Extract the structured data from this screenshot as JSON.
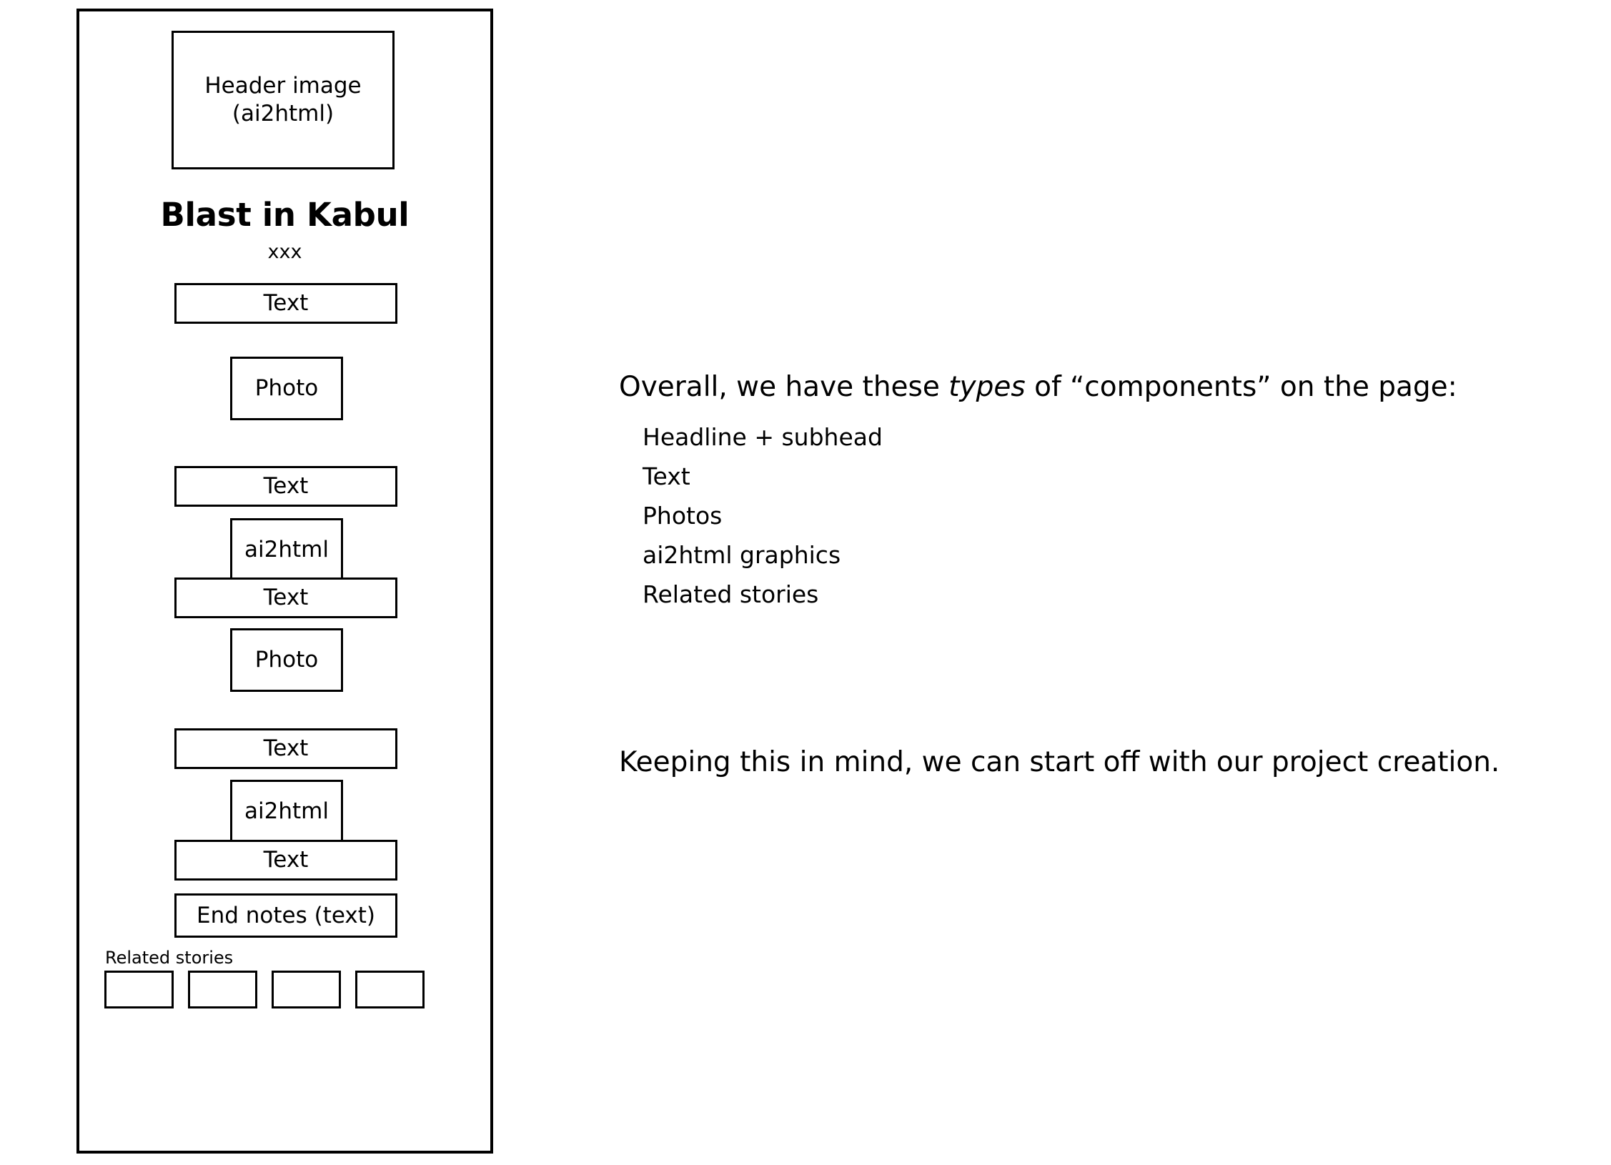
{
  "mockup": {
    "header_image": "Header image\n(ai2html)",
    "header_image_line1": "Header image",
    "header_image_line2": "(ai2html)",
    "headline": "Blast in Kabul",
    "subhead": "xxx",
    "blocks": [
      {
        "id": "text-box-1",
        "label": "Text",
        "kind": "text"
      },
      {
        "id": "photo-box-1",
        "label": "Photo",
        "kind": "photo"
      },
      {
        "id": "text-box-2",
        "label": "Text",
        "kind": "text"
      },
      {
        "id": "ai2html-box-1",
        "label": "ai2html",
        "kind": "graphic"
      },
      {
        "id": "text-box-3",
        "label": "Text",
        "kind": "text"
      },
      {
        "id": "photo-box-2",
        "label": "Photo",
        "kind": "photo"
      },
      {
        "id": "text-box-4",
        "label": "Text",
        "kind": "text"
      },
      {
        "id": "ai2html-box-2",
        "label": "ai2html",
        "kind": "graphic"
      },
      {
        "id": "text-box-5",
        "label": "Text",
        "kind": "text"
      },
      {
        "id": "end-notes-box",
        "label": "End notes (text)",
        "kind": "endnotes"
      }
    ],
    "related_stories_label": "Related stories",
    "related_stories_cards": [
      "",
      "",
      "",
      ""
    ]
  },
  "notes": {
    "intro_part1": "Overall, we have these ",
    "intro_emphasis": "types",
    "intro_part2": " of “components” on the page:",
    "component_types": [
      "Headline + subhead",
      "Text",
      "Photos",
      "ai2html graphics",
      "Related stories"
    ],
    "closing": "Keeping this in mind, we can start off with our project creation."
  },
  "colors": {
    "ink": "#000000",
    "paper": "#ffffff"
  }
}
